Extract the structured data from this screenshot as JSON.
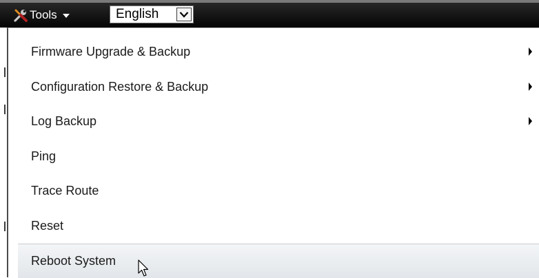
{
  "toolbar": {
    "tools_label": "Tools",
    "tools_icon": "tools-icon",
    "language": {
      "selected": "English"
    }
  },
  "menu": {
    "items": [
      {
        "label": "Firmware Upgrade & Backup",
        "has_submenu": true
      },
      {
        "label": "Configuration Restore & Backup",
        "has_submenu": true
      },
      {
        "label": "Log Backup",
        "has_submenu": true
      },
      {
        "label": "Ping",
        "has_submenu": false
      },
      {
        "label": "Trace Route",
        "has_submenu": false
      },
      {
        "label": "Reset",
        "has_submenu": false
      },
      {
        "label": "Reboot System",
        "has_submenu": false,
        "hovered": true
      }
    ]
  },
  "colors": {
    "toolbar_bg": "#111111",
    "menu_bg": "#ffffff",
    "hover_bg": "#e6e9ec",
    "text": "#1a1a1a"
  }
}
